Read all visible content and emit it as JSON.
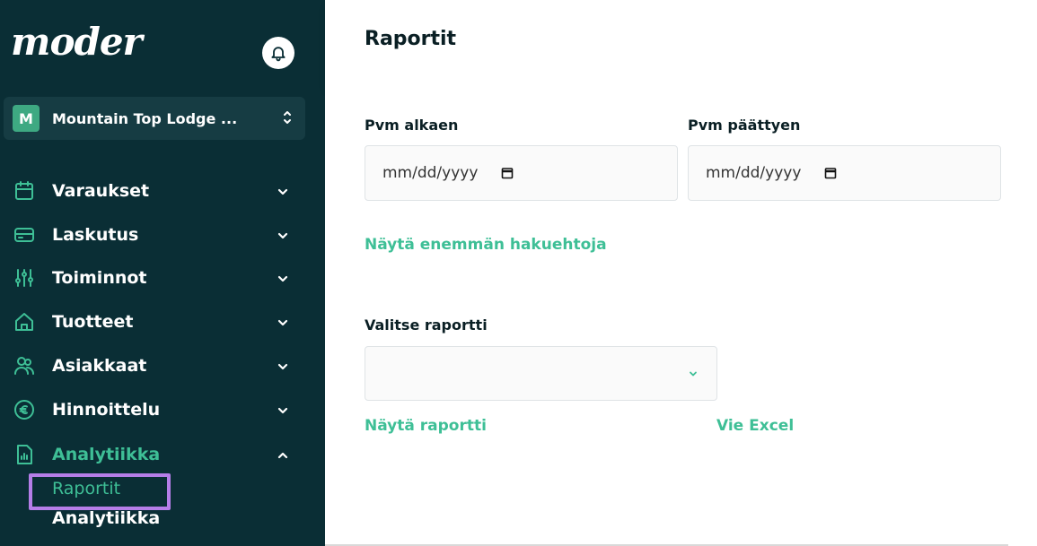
{
  "app": {
    "logo": "moder",
    "page_title": "Raportit"
  },
  "property_selector": {
    "badge": "M",
    "name": "Mountain Top Lodge ..."
  },
  "sidebar": {
    "items": [
      {
        "label": "Varaukset",
        "icon": "calendar-icon",
        "expanded": false
      },
      {
        "label": "Laskutus",
        "icon": "credit-card-icon",
        "expanded": false
      },
      {
        "label": "Toiminnot",
        "icon": "sliders-icon",
        "expanded": false
      },
      {
        "label": "Tuotteet",
        "icon": "home-icon",
        "expanded": false
      },
      {
        "label": "Asiakkaat",
        "icon": "users-icon",
        "expanded": false
      },
      {
        "label": "Hinnoittelu",
        "icon": "euro-icon",
        "expanded": false
      },
      {
        "label": "Analytiikka",
        "icon": "analytics-icon",
        "expanded": true
      }
    ],
    "sub_items": [
      {
        "label": "Raportit",
        "active": true
      },
      {
        "label": "Analytiikka",
        "active": false
      }
    ]
  },
  "filters": {
    "date_from_label": "Pvm alkaen",
    "date_from_placeholder": "mm/dd/yyyy",
    "date_to_label": "Pvm päättyen",
    "date_to_placeholder": "mm/dd/yyyy",
    "more_filters_link": "Näytä enemmän hakuehtoja"
  },
  "report": {
    "select_label": "Valitse raportti",
    "selected_value": "",
    "show_report_link": "Näytä raportti",
    "export_excel_link": "Vie Excel"
  },
  "colors": {
    "sidebar_bg": "#0a2e35",
    "accent": "#3ebf96",
    "highlight": "#b57ee8"
  }
}
